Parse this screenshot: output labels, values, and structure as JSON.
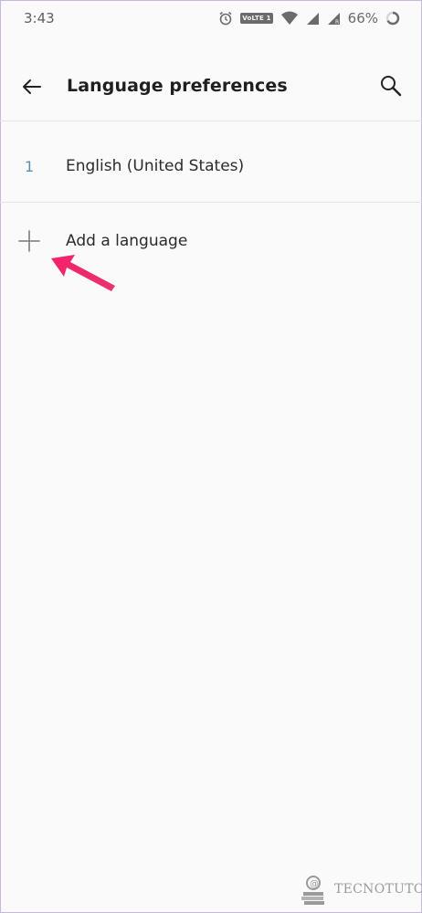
{
  "status_bar": {
    "time": "3:43",
    "network_badge": "VoLTE 1",
    "battery_percent": "66%",
    "icons": [
      "alarm-icon",
      "volte-badge",
      "wifi-icon",
      "signal-icon",
      "signal-roaming-icon",
      "battery-icon"
    ]
  },
  "app_bar": {
    "title": "Language preferences",
    "back_icon": "arrow-left-icon",
    "search_icon": "search-icon"
  },
  "languages": [
    {
      "index": "1",
      "name": "English (United States)"
    }
  ],
  "add_language": {
    "label": "Add a language",
    "icon": "plus-icon"
  },
  "annotation": {
    "arrow_color": "#f0226b"
  },
  "watermark": {
    "text": "TECNOTUTO"
  },
  "colors": {
    "background": "#fafafa",
    "index_accent": "#5b8fb2",
    "divider": "#e4e4e4"
  }
}
